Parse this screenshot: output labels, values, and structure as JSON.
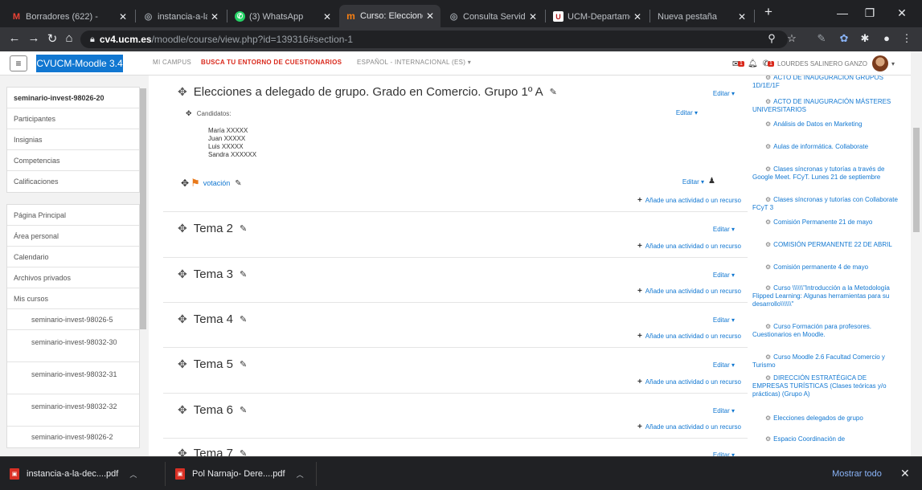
{
  "browser": {
    "tabs": [
      {
        "title": "Borradores (622) - ",
        "icon": "gmail-icon",
        "color": "#ea4335",
        "glyph": "M"
      },
      {
        "title": "instancia-a-la-dec",
        "icon": "globe-icon",
        "color": "#5f6368",
        "glyph": "◎"
      },
      {
        "title": "(3) WhatsApp",
        "icon": "whatsapp-icon",
        "color": "#25d366",
        "glyph": "◉"
      },
      {
        "title": "Curso: Elecciones",
        "icon": "moodle-icon",
        "color": "#f98012",
        "glyph": "m"
      },
      {
        "title": "Consulta Servidor",
        "icon": "globe-icon",
        "color": "#5f6368",
        "glyph": "◎"
      },
      {
        "title": "UCM-Departamen",
        "icon": "ucm-icon",
        "color": "#b71c1c",
        "glyph": "U"
      },
      {
        "title": "Nueva pestaña",
        "icon": "newtab-icon",
        "color": "#202124",
        "glyph": ""
      }
    ],
    "new_tab": "+",
    "url_host": "cv4.ucm.es",
    "url_path": "/moodle/course/view.php?id=139316#section-1"
  },
  "moodle": {
    "brand": "CVUCM-Moodle 3.4",
    "nav": {
      "campus": "MI CAMPUS",
      "quiz": "BUSCA TU ENTORNO DE CUESTIONARIOS",
      "lang": "ESPAÑOL - INTERNACIONAL (ES) ▾"
    },
    "user": "LOURDES SALINERO GANZO",
    "badges": {
      "msg": "1",
      "notif": "1"
    },
    "colors": {
      "brand": "#1177d1",
      "quiz": "#d9281b"
    }
  },
  "drawer": {
    "course": "seminario-invest-98026-20",
    "course_items": [
      "Participantes",
      "Insignias",
      "Competencias",
      "Calificaciones"
    ],
    "site_items": [
      "Página Principal",
      "Área personal",
      "Calendario",
      "Archivos privados",
      "Mis cursos"
    ],
    "my_courses": [
      "seminario-invest-98026-5",
      "seminario-invest-98032-30",
      "seminario-invest-98032-31",
      "seminario-invest-98032-32",
      "seminario-invest-98026-2"
    ]
  },
  "main": {
    "edit_label": "Editar ▾",
    "add_label": "Añade una actividad o un recurso",
    "section1": {
      "title": "Elecciones a delegado de grupo. Grado en Comercio. Grupo 1º A",
      "label_title": "Candidatos:",
      "candidates": [
        "María XXXXX",
        "Juan XXXXX",
        "Luis XXXXX",
        "Sandra XXXXXX"
      ],
      "activity": "votación"
    },
    "topics": [
      "Tema 2",
      "Tema 3",
      "Tema 4",
      "Tema 5",
      "Tema 6",
      "Tema 7"
    ]
  },
  "right_block": {
    "items": [
      "ACTO DE INAUGURACIÓN GRUPOS 1D/1E/1F",
      "ACTO DE INAUGURACIÓN MÁSTERES UNIVERSITARIOS",
      "Análisis de Datos en Marketing",
      "Aulas de informática. Collaborate",
      "Clases síncronas y tutorías a través de Google Meet. FCyT. Lunes 21 de septiembre",
      "Clases síncronas y tutorías con Collaborate FCyT 3",
      "Comisión Permanente 21 de mayo",
      "COMISIÓN PERMANENTE 22 DE ABRIL",
      "Comisión permanente 4 de mayo",
      "Curso \\\\\\\\\\\\\"Introducción a la Metodología Flipped Learning: Algunas herramientas para su desarrollo\\\\\\\\\\\\\"",
      "Curso Formación para profesores. Cuestionarios en Moodle.",
      "Curso Moodle 2.6 Facultad Comercio y Turismo",
      "DIRECCIÓN ESTRATÉGICA DE EMPRESAS TURÍSTICAS (Clases teóricas y/o prácticas) (Grupo A)",
      "Elecciones delegados de grupo",
      "Espacio Coordinación de"
    ]
  },
  "downloads": {
    "files": [
      "instancia-a-la-dec....pdf",
      "Pol Narnajo- Dere....pdf"
    ],
    "show_all": "Mostrar todo"
  }
}
